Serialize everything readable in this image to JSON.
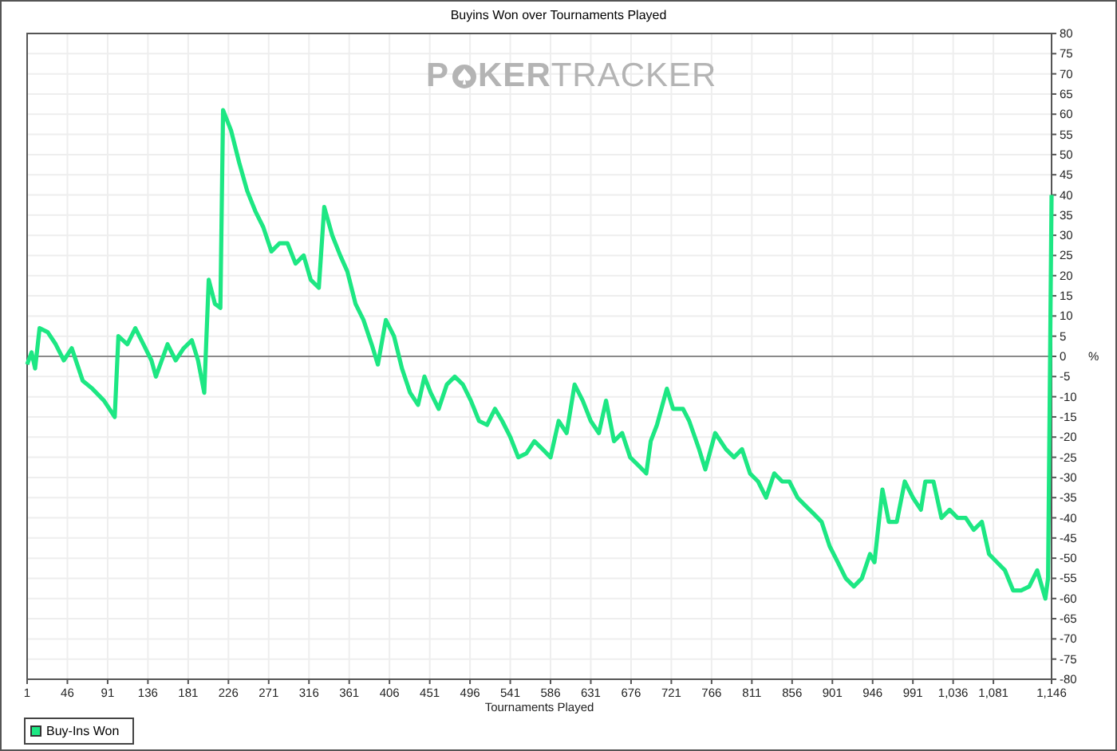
{
  "chart": {
    "logo": {
      "parts": [
        "P",
        "KER",
        "TRACKER"
      ]
    },
    "chart_data": {
      "type": "line",
      "grid": true,
      "title": "Buyins Won over Tournaments Played",
      "xlabel": "Tournaments Played",
      "ylabel": "%",
      "x": [
        1,
        6,
        10,
        15,
        24,
        33,
        42,
        51,
        63,
        74,
        87,
        99,
        103,
        113,
        122,
        131,
        140,
        145,
        158,
        167,
        176,
        185,
        192,
        199,
        204,
        211,
        217,
        220,
        229,
        238,
        247,
        256,
        265,
        274,
        283,
        292,
        301,
        310,
        318,
        327,
        333,
        342,
        351,
        359,
        368,
        377,
        386,
        393,
        402,
        411,
        420,
        429,
        438,
        445,
        452,
        461,
        470,
        479,
        488,
        497,
        506,
        515,
        524,
        532,
        541,
        550,
        559,
        568,
        577,
        586,
        595,
        604,
        613,
        622,
        631,
        640,
        648,
        657,
        666,
        675,
        684,
        693,
        698,
        705,
        716,
        723,
        734,
        741,
        752,
        759,
        770,
        782,
        791,
        800,
        809,
        818,
        827,
        836,
        845,
        853,
        862,
        871,
        880,
        889,
        898,
        907,
        916,
        925,
        934,
        943,
        948,
        957,
        964,
        973,
        982,
        991,
        1000,
        1005,
        1014,
        1023,
        1032,
        1041,
        1050,
        1059,
        1068,
        1076,
        1085,
        1094,
        1103,
        1112,
        1121,
        1130,
        1139,
        1142,
        1146
      ],
      "series": [
        {
          "name": "Buy-Ins Won",
          "color": "#1de783",
          "values": [
            -2,
            1,
            -3,
            7,
            6,
            3,
            -1,
            2,
            -6,
            -8,
            -11,
            -15,
            5,
            3,
            7,
            3,
            -1,
            -5,
            3,
            -1,
            2,
            4,
            -1,
            -9,
            19,
            13,
            12,
            61,
            56,
            48,
            41,
            36,
            32,
            26,
            28,
            28,
            23,
            25,
            19,
            17,
            37,
            30,
            25,
            21,
            13,
            9,
            3,
            -2,
            9,
            5,
            -3,
            -9,
            -12,
            -5,
            -9,
            -13,
            -7,
            -5,
            -7,
            -11,
            -16,
            -17,
            -13,
            -16,
            -20,
            -25,
            -24,
            -21,
            -23,
            -25,
            -16,
            -19,
            -7,
            -11,
            -16,
            -19,
            -11,
            -21,
            -19,
            -25,
            -27,
            -29,
            -21,
            -17,
            -8,
            -13,
            -13,
            -16,
            -23,
            -28,
            -19,
            -23,
            -25,
            -23,
            -29,
            -31,
            -35,
            -29,
            -31,
            -31,
            -35,
            -37,
            -39,
            -41,
            -47,
            -51,
            -55,
            -57,
            -55,
            -49,
            -51,
            -33,
            -41,
            -41,
            -31,
            -35,
            -38,
            -31,
            -31,
            -40,
            -38,
            -40,
            -40,
            -43,
            -41,
            -49,
            -51,
            -53,
            -58,
            -58,
            -57,
            -53,
            -60,
            -55,
            40
          ]
        }
      ],
      "xlim": [
        1,
        1146
      ],
      "ylim": [
        -80,
        80
      ],
      "xticks": [
        1,
        46,
        91,
        136,
        181,
        226,
        271,
        316,
        361,
        406,
        451,
        496,
        541,
        586,
        631,
        676,
        721,
        766,
        811,
        856,
        901,
        946,
        991,
        {
          "value": 1036,
          "label": "1,036"
        },
        {
          "value": 1081,
          "label": "1,081"
        },
        {
          "value": 1146,
          "label": "1,146"
        }
      ],
      "yticks": [
        -80,
        -75,
        -70,
        -65,
        -60,
        -55,
        -50,
        -45,
        -40,
        -35,
        -30,
        -25,
        -20,
        -15,
        -10,
        -5,
        0,
        5,
        10,
        15,
        20,
        25,
        30,
        35,
        40,
        45,
        50,
        55,
        60,
        65,
        70,
        75,
        80
      ]
    }
  }
}
